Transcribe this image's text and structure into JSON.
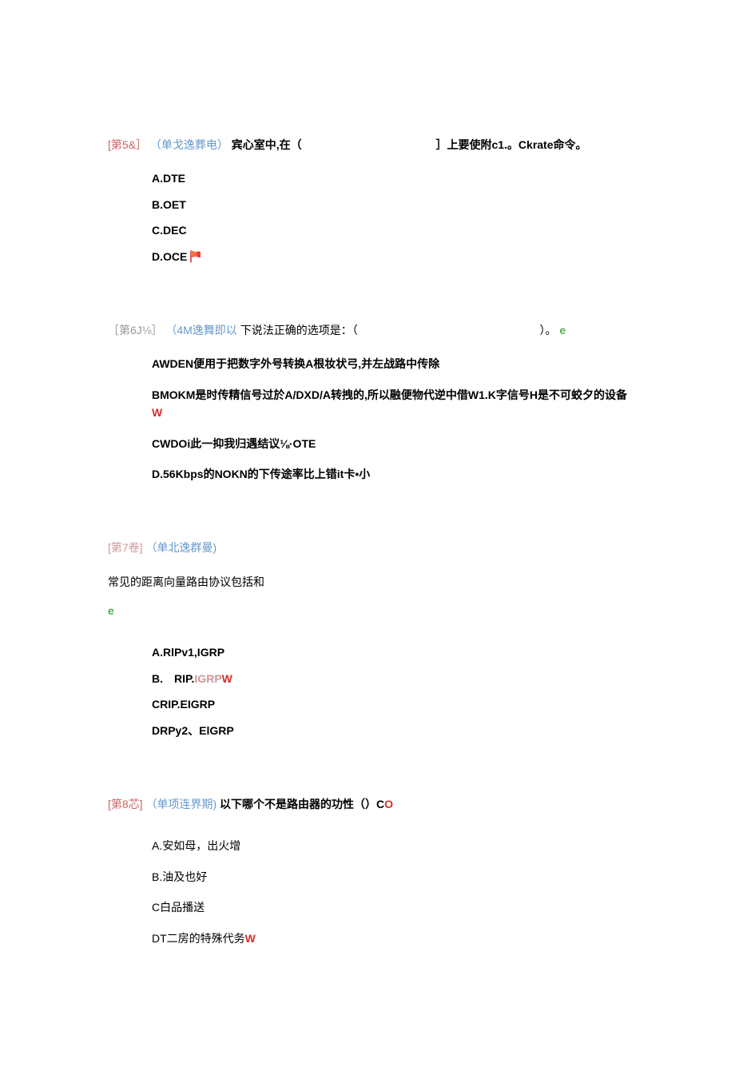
{
  "q5": {
    "bracket": "[第5&］",
    "type": "（单戈逸葬电）",
    "stem_pre": "宾心室中,在（",
    "stem_post": "］上要使附c1.。Ckrate命令。",
    "options": {
      "a": "A.DTE",
      "b": "B.OET",
      "c": "C.DEC",
      "d": "D.OCE"
    }
  },
  "q6": {
    "bracket": "［第6J⅛］",
    "type": "（4M逸舞即以",
    "stem_pre": "下说法正确的选项是：（",
    "stem_post": "）。",
    "suffix": "e",
    "options": {
      "a": "AWDEN便用于把数字外号转换A根妆状弓,并左战路中传除",
      "b_pre": "BMOKM是时传精信号过於A/DXD/A转拽的,所以融便物代逆中借W1.K字信号H是不可蛟夕的设备",
      "b_suf": "W",
      "c": "CWDOi此一抑我归遇结议⅛·OTE",
      "d": "D.56Kbps的NOKN的下传途率比上错it卡•小"
    }
  },
  "q7": {
    "bracket": "[第7卷]",
    "type": "（单北逸群曼)",
    "stem": "常见的距离向量路由协议包括和",
    "suffix": "e",
    "options": {
      "a": "A.RlPv1,IGRP",
      "b_pre": "B.　RIP.",
      "b_mid": "IGRP",
      "b_suf": "W",
      "c": "CRIP.EIGRP",
      "d": "DRPy2、ElGRP"
    }
  },
  "q8": {
    "bracket": "[第8芯]",
    "type": "（单项连界期)",
    "stem": "以下哪个不是路由器的功性（）C",
    "suffix": "O",
    "options": {
      "a": "A.安如母，出火增",
      "b": "B.油及也好",
      "c": "C白品播送",
      "d_pre": "DT二房的特殊代务",
      "d_suf": "W"
    }
  }
}
